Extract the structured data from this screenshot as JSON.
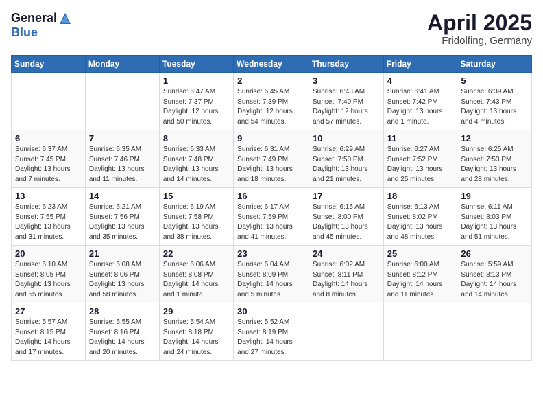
{
  "logo": {
    "general": "General",
    "blue": "Blue"
  },
  "header": {
    "month_year": "April 2025",
    "location": "Fridolfing, Germany"
  },
  "weekdays": [
    "Sunday",
    "Monday",
    "Tuesday",
    "Wednesday",
    "Thursday",
    "Friday",
    "Saturday"
  ],
  "weeks": [
    [
      {
        "day": "",
        "info": ""
      },
      {
        "day": "",
        "info": ""
      },
      {
        "day": "1",
        "info": "Sunrise: 6:47 AM\nSunset: 7:37 PM\nDaylight: 12 hours\nand 50 minutes."
      },
      {
        "day": "2",
        "info": "Sunrise: 6:45 AM\nSunset: 7:39 PM\nDaylight: 12 hours\nand 54 minutes."
      },
      {
        "day": "3",
        "info": "Sunrise: 6:43 AM\nSunset: 7:40 PM\nDaylight: 12 hours\nand 57 minutes."
      },
      {
        "day": "4",
        "info": "Sunrise: 6:41 AM\nSunset: 7:42 PM\nDaylight: 13 hours\nand 1 minute."
      },
      {
        "day": "5",
        "info": "Sunrise: 6:39 AM\nSunset: 7:43 PM\nDaylight: 13 hours\nand 4 minutes."
      }
    ],
    [
      {
        "day": "6",
        "info": "Sunrise: 6:37 AM\nSunset: 7:45 PM\nDaylight: 13 hours\nand 7 minutes."
      },
      {
        "day": "7",
        "info": "Sunrise: 6:35 AM\nSunset: 7:46 PM\nDaylight: 13 hours\nand 11 minutes."
      },
      {
        "day": "8",
        "info": "Sunrise: 6:33 AM\nSunset: 7:48 PM\nDaylight: 13 hours\nand 14 minutes."
      },
      {
        "day": "9",
        "info": "Sunrise: 6:31 AM\nSunset: 7:49 PM\nDaylight: 13 hours\nand 18 minutes."
      },
      {
        "day": "10",
        "info": "Sunrise: 6:29 AM\nSunset: 7:50 PM\nDaylight: 13 hours\nand 21 minutes."
      },
      {
        "day": "11",
        "info": "Sunrise: 6:27 AM\nSunset: 7:52 PM\nDaylight: 13 hours\nand 25 minutes."
      },
      {
        "day": "12",
        "info": "Sunrise: 6:25 AM\nSunset: 7:53 PM\nDaylight: 13 hours\nand 28 minutes."
      }
    ],
    [
      {
        "day": "13",
        "info": "Sunrise: 6:23 AM\nSunset: 7:55 PM\nDaylight: 13 hours\nand 31 minutes."
      },
      {
        "day": "14",
        "info": "Sunrise: 6:21 AM\nSunset: 7:56 PM\nDaylight: 13 hours\nand 35 minutes."
      },
      {
        "day": "15",
        "info": "Sunrise: 6:19 AM\nSunset: 7:58 PM\nDaylight: 13 hours\nand 38 minutes."
      },
      {
        "day": "16",
        "info": "Sunrise: 6:17 AM\nSunset: 7:59 PM\nDaylight: 13 hours\nand 41 minutes."
      },
      {
        "day": "17",
        "info": "Sunrise: 6:15 AM\nSunset: 8:00 PM\nDaylight: 13 hours\nand 45 minutes."
      },
      {
        "day": "18",
        "info": "Sunrise: 6:13 AM\nSunset: 8:02 PM\nDaylight: 13 hours\nand 48 minutes."
      },
      {
        "day": "19",
        "info": "Sunrise: 6:11 AM\nSunset: 8:03 PM\nDaylight: 13 hours\nand 51 minutes."
      }
    ],
    [
      {
        "day": "20",
        "info": "Sunrise: 6:10 AM\nSunset: 8:05 PM\nDaylight: 13 hours\nand 55 minutes."
      },
      {
        "day": "21",
        "info": "Sunrise: 6:08 AM\nSunset: 8:06 PM\nDaylight: 13 hours\nand 58 minutes."
      },
      {
        "day": "22",
        "info": "Sunrise: 6:06 AM\nSunset: 8:08 PM\nDaylight: 14 hours\nand 1 minute."
      },
      {
        "day": "23",
        "info": "Sunrise: 6:04 AM\nSunset: 8:09 PM\nDaylight: 14 hours\nand 5 minutes."
      },
      {
        "day": "24",
        "info": "Sunrise: 6:02 AM\nSunset: 8:11 PM\nDaylight: 14 hours\nand 8 minutes."
      },
      {
        "day": "25",
        "info": "Sunrise: 6:00 AM\nSunset: 8:12 PM\nDaylight: 14 hours\nand 11 minutes."
      },
      {
        "day": "26",
        "info": "Sunrise: 5:59 AM\nSunset: 8:13 PM\nDaylight: 14 hours\nand 14 minutes."
      }
    ],
    [
      {
        "day": "27",
        "info": "Sunrise: 5:57 AM\nSunset: 8:15 PM\nDaylight: 14 hours\nand 17 minutes."
      },
      {
        "day": "28",
        "info": "Sunrise: 5:55 AM\nSunset: 8:16 PM\nDaylight: 14 hours\nand 20 minutes."
      },
      {
        "day": "29",
        "info": "Sunrise: 5:54 AM\nSunset: 8:18 PM\nDaylight: 14 hours\nand 24 minutes."
      },
      {
        "day": "30",
        "info": "Sunrise: 5:52 AM\nSunset: 8:19 PM\nDaylight: 14 hours\nand 27 minutes."
      },
      {
        "day": "",
        "info": ""
      },
      {
        "day": "",
        "info": ""
      },
      {
        "day": "",
        "info": ""
      }
    ]
  ]
}
